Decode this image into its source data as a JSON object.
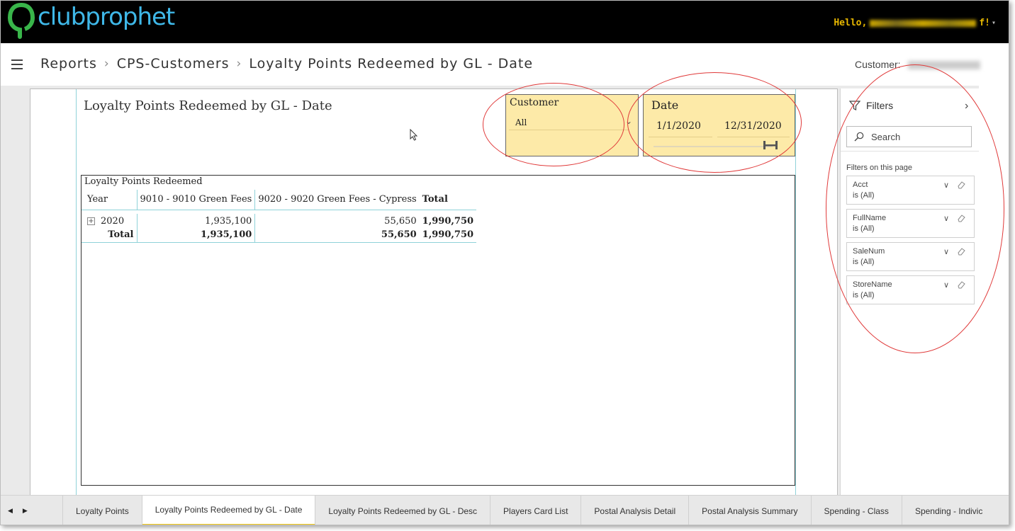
{
  "app": {
    "brand": "clubprophet"
  },
  "header": {
    "greeting": "Hello,"
  },
  "breadcrumb": {
    "items": [
      "Reports",
      "CPS-Customers",
      "Loyalty Points Redeemed by GL - Date"
    ]
  },
  "customer_label": "Customer:",
  "report": {
    "title": "Loyalty Points Redeemed by GL - Date",
    "customer_slicer": {
      "title": "Customer",
      "value": "All"
    },
    "date_slicer": {
      "title": "Date",
      "start": "1/1/2020",
      "end": "12/31/2020"
    },
    "matrix": {
      "title": "Loyalty Points Redeemed",
      "columns": [
        "Year",
        "9010 - 9010 Green Fees",
        "9020 - 9020 Green Fees - Cypress",
        "Total"
      ],
      "rows": [
        {
          "label": "2020",
          "values": [
            "1,935,100",
            "55,650",
            "1,990,750"
          ]
        }
      ],
      "total": {
        "label": "Total",
        "values": [
          "1,935,100",
          "55,650",
          "1,990,750"
        ]
      }
    }
  },
  "filters": {
    "title": "Filters",
    "search_placeholder": "Search",
    "section": "Filters on this page",
    "cards": [
      {
        "name": "Acct",
        "value": "is (All)"
      },
      {
        "name": "FullName",
        "value": "is (All)"
      },
      {
        "name": "SaleNum",
        "value": "is (All)"
      },
      {
        "name": "StoreName",
        "value": "is (All)"
      }
    ]
  },
  "tabs": {
    "items": [
      "Loyalty Points",
      "Loyalty Points Redeemed by GL - Date",
      "Loyalty Points Redeemed by GL - Desc",
      "Players Card List",
      "Postal Analysis Detail",
      "Postal Analysis Summary",
      "Spending - Class",
      "Spending - Indivic"
    ],
    "active": "Loyalty Points Redeemed by GL - Date"
  },
  "colors": {
    "brand": "#3fb8e8",
    "slicer_bg": "#fdeaa8",
    "annotation": "#e03a3a",
    "active_tab": "#f2c811",
    "greeting": "#e8b800"
  }
}
